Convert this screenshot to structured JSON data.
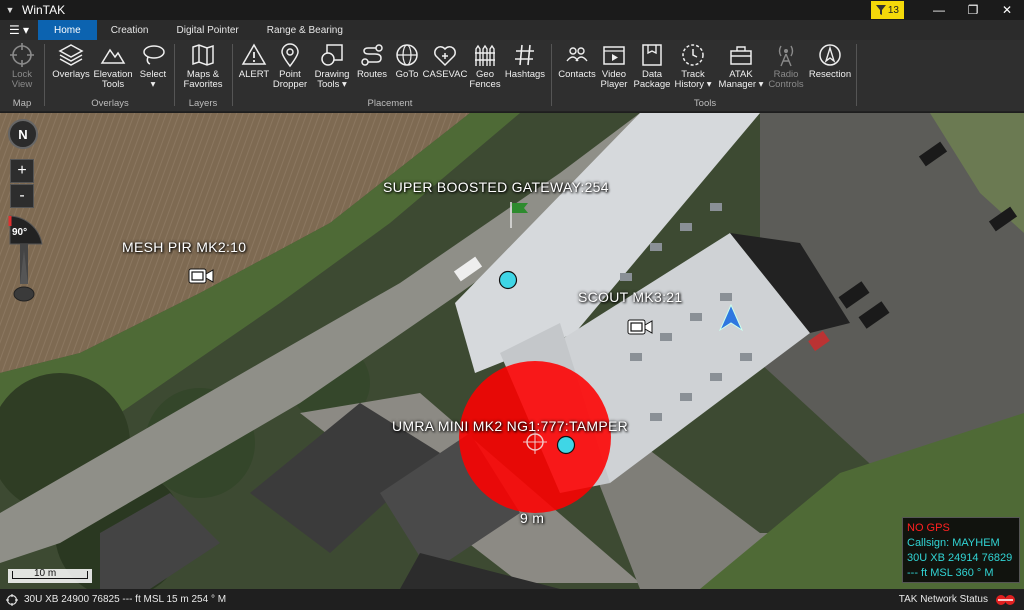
{
  "window": {
    "title": "WinTAK",
    "filter_count": "13",
    "menu_icon": "hamburger-icon"
  },
  "tabs": [
    "Home",
    "Creation",
    "Digital Pointer",
    "Range & Bearing"
  ],
  "ribbon": {
    "map": {
      "lock_view": [
        "Lock",
        "View"
      ],
      "group": "Map"
    },
    "overlays": {
      "overlays": "Overlays",
      "elevation": [
        "Elevation",
        "Tools"
      ],
      "select": "Select",
      "group": "Overlays"
    },
    "layers": {
      "maps": [
        "Maps &",
        "Favorites"
      ],
      "group": "Layers"
    },
    "placement": {
      "alert": "ALERT",
      "point": [
        "Point",
        "Dropper"
      ],
      "drawing": [
        "Drawing",
        "Tools"
      ],
      "routes": "Routes",
      "goto": "GoTo",
      "casevac": "CASEVAC",
      "geo": [
        "Geo",
        "Fences"
      ],
      "hashtags": "Hashtags",
      "group": "Placement"
    },
    "tools": {
      "contacts": "Contacts",
      "video": [
        "Video",
        "Player"
      ],
      "data": [
        "Data",
        "Package"
      ],
      "track": [
        "Track",
        "History"
      ],
      "atak": [
        "ATAK",
        "Manager"
      ],
      "radio": [
        "Radio",
        "Controls"
      ],
      "resection": "Resection",
      "group": "Tools"
    }
  },
  "map": {
    "labels": {
      "gateway": "SUPER BOOSTED GATEWAY:254",
      "mesh": "MESH PIR MK2:10",
      "scout": "SCOUT MK3:21",
      "umra": "UMRA MINI MK2 NG1:777:TAMPER",
      "radius": "9 m"
    },
    "compass": "N",
    "heading": "90°",
    "zoom_in": "+",
    "zoom_out": "-",
    "scale": "10 m"
  },
  "info": {
    "gps": "NO GPS",
    "callsign": "Callsign: MAYHEM",
    "grid": "30U  XB  24914  76829",
    "alt": "--- ft MSL        360 ° M"
  },
  "status": {
    "coords": "30U  XB  24900  76825   --- ft MSL   15 m  254 ° M",
    "network": "TAK Network Status"
  }
}
